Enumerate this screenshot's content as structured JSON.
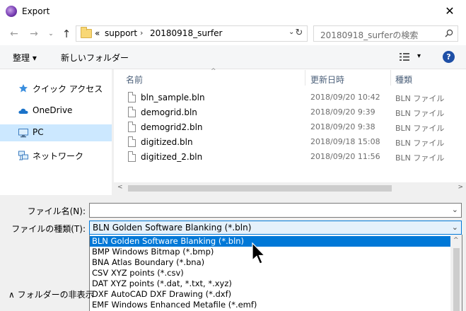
{
  "window": {
    "title": "Export",
    "close": "✕"
  },
  "nav": {
    "back": "←",
    "forward": "→",
    "recent": "⌄",
    "up": "↑"
  },
  "address": {
    "prefix": "«",
    "crumbs": [
      "support",
      "20180918_surfer"
    ],
    "sep": "›",
    "dropdown": "⌄",
    "refresh": "↻"
  },
  "search": {
    "placeholder": "20180918_surferの検索"
  },
  "toolbar": {
    "organize": "整理 ▾",
    "new_folder": "新しいフォルダー",
    "view_dd": "▾",
    "help": "?"
  },
  "sidebar": {
    "items": [
      {
        "label": "クイック アクセス",
        "icon": "star-icon"
      },
      {
        "label": "OneDrive",
        "icon": "cloud-icon"
      },
      {
        "label": "PC",
        "icon": "computer-icon",
        "selected": true
      },
      {
        "label": "ネットワーク",
        "icon": "network-icon"
      }
    ]
  },
  "columns": {
    "name": "名前",
    "date": "更新日時",
    "type": "種類",
    "sort": "^"
  },
  "files": [
    {
      "name": "bln_sample.bln",
      "date": "2018/09/20 10:42",
      "type": "BLN ファイル"
    },
    {
      "name": "demogrid.bln",
      "date": "2018/09/20 9:39",
      "type": "BLN ファイル"
    },
    {
      "name": "demogrid2.bln",
      "date": "2018/09/20 9:38",
      "type": "BLN ファイル"
    },
    {
      "name": "digitized.bln",
      "date": "2018/09/18 15:08",
      "type": "BLN ファイル"
    },
    {
      "name": "digitized_2.bln",
      "date": "2018/09/20 11:56",
      "type": "BLN ファイル"
    }
  ],
  "scroll": {
    "left": "<",
    "right": ">",
    "up": "^"
  },
  "form": {
    "filename_label": "ファイル名(N):",
    "filename_value": "",
    "filetype_label": "ファイルの種類(T):",
    "filetype_value": "BLN Golden Software Blanking (*.bln)",
    "dropdown": "⌄"
  },
  "filetype_options": [
    "BLN Golden Software Blanking (*.bln)",
    "BMP Windows Bitmap (*.bmp)",
    "BNA Atlas Boundary (*.bna)",
    "CSV XYZ points (*.csv)",
    "DAT XYZ points (*.dat, *.txt, *.xyz)",
    "DXF AutoCAD DXF Drawing (*.dxf)",
    "EMF Windows Enhanced Metafile (*.emf)"
  ],
  "footer": {
    "hide_folders": "∧  フォルダーの非表示"
  },
  "colors": {
    "accent": "#0078d7",
    "selected_bg": "#cce8ff",
    "help_bg": "#1e4fa6"
  }
}
